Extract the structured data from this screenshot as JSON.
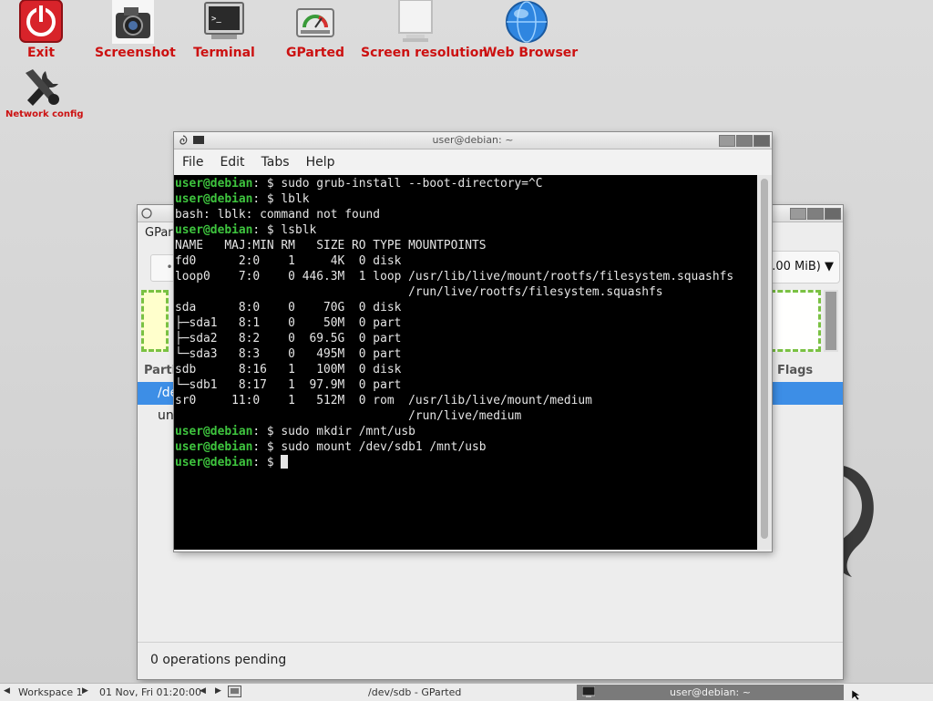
{
  "desktop_icons": [
    {
      "label": "Exit",
      "icon": "power-icon"
    },
    {
      "label": "Screenshot",
      "icon": "camera-icon"
    },
    {
      "label": "Terminal",
      "icon": "terminal-icon"
    },
    {
      "label": "GParted",
      "icon": "disk-gauge-icon"
    },
    {
      "label": "Screen resolution",
      "icon": "monitor-icon"
    },
    {
      "label": "Web Browser",
      "icon": "globe-icon"
    },
    {
      "label": "Network config",
      "icon": "wrench-icon"
    }
  ],
  "terminal": {
    "title": "user@debian: ~",
    "menu": [
      "File",
      "Edit",
      "Tabs",
      "Help"
    ],
    "lines": [
      {
        "prompt": "user@debian",
        "sep": ": $ ",
        "text": "sudo grub-install --boot-directory=^C"
      },
      {
        "prompt": "user@debian",
        "sep": ": $ ",
        "text": "lblk"
      },
      {
        "prompt": "",
        "sep": "",
        "text": "bash: lblk: command not found"
      },
      {
        "prompt": "user@debian",
        "sep": ": $ ",
        "text": "lsblk"
      },
      {
        "prompt": "",
        "sep": "",
        "text": "NAME   MAJ:MIN RM   SIZE RO TYPE MOUNTPOINTS"
      },
      {
        "prompt": "",
        "sep": "",
        "text": "fd0      2:0    1     4K  0 disk"
      },
      {
        "prompt": "",
        "sep": "",
        "text": "loop0    7:0    0 446.3M  1 loop /usr/lib/live/mount/rootfs/filesystem.squashfs"
      },
      {
        "prompt": "",
        "sep": "",
        "text": "                                 /run/live/rootfs/filesystem.squashfs"
      },
      {
        "prompt": "",
        "sep": "",
        "text": "sda      8:0    0    70G  0 disk"
      },
      {
        "prompt": "",
        "sep": "",
        "text": "├─sda1   8:1    0    50M  0 part"
      },
      {
        "prompt": "",
        "sep": "",
        "text": "├─sda2   8:2    0  69.5G  0 part"
      },
      {
        "prompt": "",
        "sep": "",
        "text": "└─sda3   8:3    0   495M  0 part"
      },
      {
        "prompt": "",
        "sep": "",
        "text": "sdb      8:16   1   100M  0 disk"
      },
      {
        "prompt": "",
        "sep": "",
        "text": "└─sdb1   8:17   1  97.9M  0 part"
      },
      {
        "prompt": "",
        "sep": "",
        "text": "sr0     11:0    1   512M  0 rom  /usr/lib/live/mount/medium"
      },
      {
        "prompt": "",
        "sep": "",
        "text": "                                 /run/live/medium"
      },
      {
        "prompt": "user@debian",
        "sep": ": $ ",
        "text": "sudo mkdir /mnt/usb"
      },
      {
        "prompt": "user@debian",
        "sep": ": $ ",
        "text": "sudo mount /dev/sdb1 /mnt/usb"
      },
      {
        "prompt": "user@debian",
        "sep": ": $ ",
        "text": ""
      }
    ]
  },
  "gparted": {
    "menu_fragment": "GPar",
    "toolbar_fragment": "•",
    "device_selector": ".00 MiB)",
    "column_partition_fragment": "Partit",
    "column_flags": "Flags",
    "row1_fragment": "/dev",
    "row2_fragment": "un",
    "status": "0 operations pending"
  },
  "taskbar": {
    "workspace": "Workspace 1",
    "datetime": "01 Nov, Fri 01:20:00",
    "task_gparted": "/dev/sdb - GParted",
    "task_terminal": "user@debian: ~"
  },
  "colors": {
    "desktop_label": "#cc1111",
    "prompt": "#3ec43e",
    "selection": "#3d8ee6"
  }
}
